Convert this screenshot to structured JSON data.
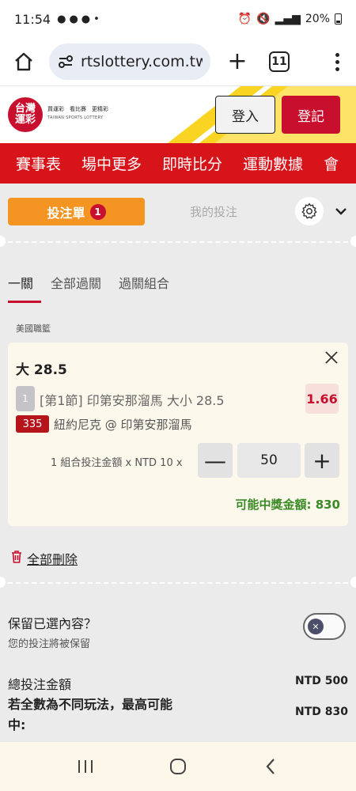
{
  "status_bar": {
    "time": "11:54",
    "battery": "20%",
    "icons": [
      "notification-icon",
      "notification-icon",
      "notification-icon",
      "alarm-icon",
      "mute-icon",
      "volte-icon",
      "5g-icon",
      "signal-icon",
      "battery-icon"
    ]
  },
  "browser": {
    "url": "rtslottery.com.tw",
    "tab_count": "11"
  },
  "brand": {
    "logo_text": "台灣運彩",
    "tagline_zh": "買運彩　看比賽　更精彩",
    "tagline_en": "TAIWAN SPORTS LOTTERY",
    "login_label": "登入",
    "register_label": "登記",
    "accent_red": "#d7141a",
    "accent_yellow": "#f9d423"
  },
  "nav": {
    "items": [
      "賽事表",
      "場中更多",
      "即時比分",
      "運動數據",
      "會"
    ]
  },
  "betslip": {
    "tab_slip_label": "投注單",
    "tab_slip_count": "1",
    "tab_mybets_label": "我的投注",
    "subtabs": [
      "一關",
      "全部過關",
      "過關組合"
    ],
    "league": "美國職籃",
    "bet": {
      "title": "大 28.5",
      "index": "1",
      "market": "[第1節] 印第安那溜馬 大小 28.5",
      "odds": "1.66",
      "game_number": "335",
      "match": "紐約尼克 @ 印第安那溜馬",
      "stake_label": "1 組合投注金額 x NTD 10 x",
      "stake_value": "50",
      "minus_symbol": "—",
      "plus_symbol": "+",
      "winnings_label": "可能中獎金額:",
      "winnings_value": "830"
    },
    "delete_all_label": "全部刪除",
    "keep_question": "保留已選內容？",
    "keep_hint": "您的投注將被保留",
    "total_label": "總投注金額",
    "total_value": "NTD 500",
    "maxwin_label": "若全數為不同玩法，最高可能中:",
    "maxwin_value": "NTD 830"
  }
}
